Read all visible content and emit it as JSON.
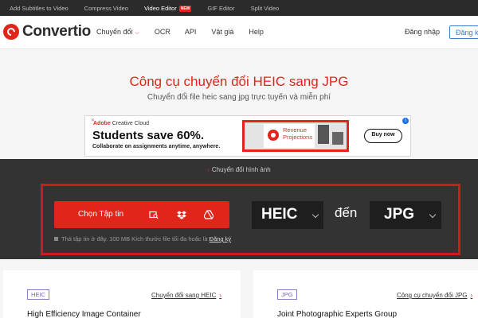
{
  "topbar": {
    "items": [
      {
        "label": "Add Subtitles to Video"
      },
      {
        "label": "Compress Video"
      },
      {
        "label": "Video Editor",
        "badge": "NEW"
      },
      {
        "label": "GIF Editor"
      },
      {
        "label": "Split Video"
      }
    ]
  },
  "header": {
    "logo_text": "Convertio",
    "nav": [
      {
        "label": "Chuyển đổi",
        "has_dropdown": true,
        "icon": "chevron-down-icon"
      },
      {
        "label": "OCR"
      },
      {
        "label": "API"
      },
      {
        "label": "Vật giá"
      },
      {
        "label": "Help"
      }
    ],
    "login_label": "Đăng nhập",
    "signup_label": "Đăng ký"
  },
  "hero": {
    "title": "Công cụ chuyển đổi HEIC sang JPG",
    "subtitle": "Chuyển đổi file heic sang jpg trực tuyến và miễn phí"
  },
  "ad": {
    "brand_adobe": "Adobe",
    "brand_product": "Creative Cloud",
    "headline": "Students save 60%.",
    "copy": "Collaborate on assignments anytime, anywhere.",
    "image_text": "Revenue Projections",
    "button_label": "Buy now",
    "info_icon": "info-icon",
    "close_icon": "close-icon"
  },
  "converter": {
    "breadcrumb": "Chuyển đổi hình ảnh",
    "choose_label": "Chọn Tập tin",
    "upload_icons": [
      "folder-search-icon",
      "dropbox-icon",
      "google-drive-icon"
    ],
    "from_format": "HEIC",
    "to_word": "đến",
    "to_format": "JPG",
    "hint_text": "Thả tập tin ở đây. 100 MB Kích thước file tối đa hoặc là",
    "hint_link": "Đăng ký"
  },
  "cards": [
    {
      "tag": "HEIC",
      "link": "Chuyển đổi sang HEIC",
      "title": "High Efficiency Image Container"
    },
    {
      "tag": "JPG",
      "link": "Công cụ chuyển đổi JPG",
      "title": "Joint Photographic Experts Group"
    }
  ],
  "colors": {
    "accent_red": "#e1251b",
    "dark_panel": "#333333",
    "format_box": "#1e1e1e",
    "link_blue": "#3d7cc9"
  }
}
